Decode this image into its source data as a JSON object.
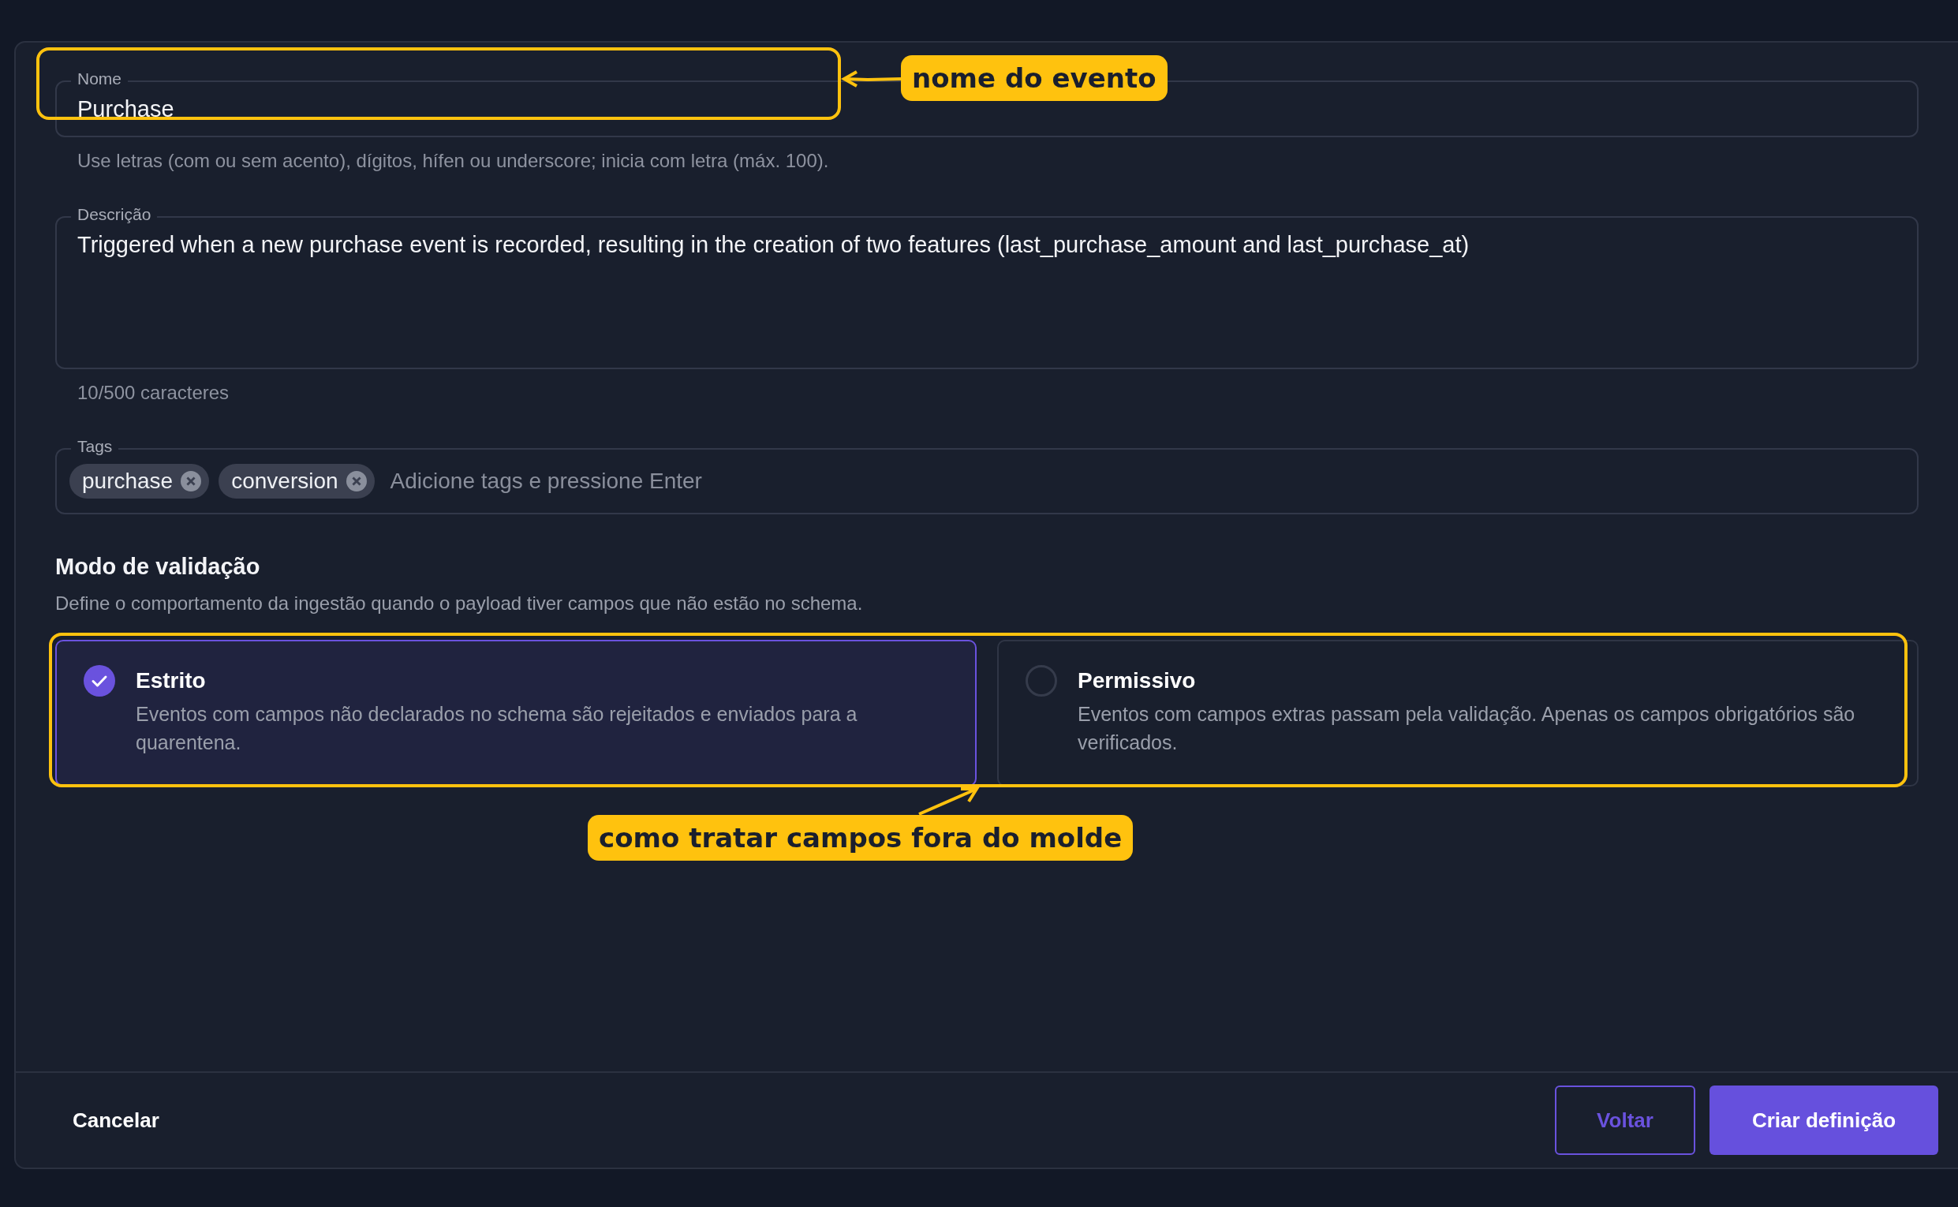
{
  "form": {
    "name_field": {
      "label": "Nome",
      "value": "Purchase",
      "hint": "Use letras (com ou sem acento), dígitos, hífen ou underscore; inicia com letra (máx. 100)."
    },
    "description_field": {
      "label": "Descrição",
      "value": "Triggered when a new purchase event is recorded, resulting in the creation of two features (last_purchase_amount and last_purchase_at)",
      "counter": "10/500 caracteres"
    },
    "tags_field": {
      "label": "Tags",
      "tags": [
        "purchase",
        "conversion"
      ],
      "placeholder": "Adicione tags e pressione Enter"
    },
    "validation": {
      "title": "Modo de validação",
      "description": "Define o comportamento da ingestão quando o payload tiver campos que não estão no schema.",
      "options": [
        {
          "title": "Estrito",
          "description": "Eventos com campos não declarados no schema são rejeitados e enviados para a quarentena.",
          "selected": true
        },
        {
          "title": "Permissivo",
          "description": "Eventos com campos extras passam pela validação. Apenas os campos obrigatórios são verificados.",
          "selected": false
        }
      ]
    }
  },
  "footer": {
    "cancel": "Cancelar",
    "back": "Voltar",
    "submit": "Criar definição"
  },
  "annotations": [
    {
      "text": "nome do evento"
    },
    {
      "text": "como tratar campos fora do molde"
    }
  ]
}
